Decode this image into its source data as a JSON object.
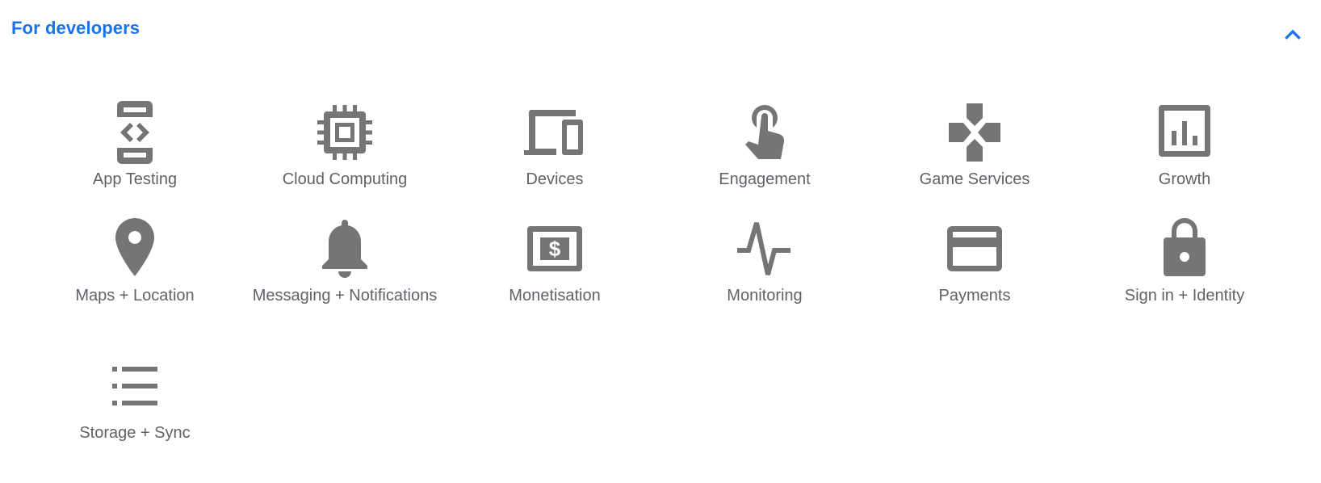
{
  "header": {
    "title": "For developers",
    "collapse_icon": "chevron-up-icon"
  },
  "colors": {
    "accent": "#1a73e8",
    "icon": "#757575",
    "label": "#5f6368",
    "background": "#ffffff"
  },
  "products": [
    {
      "label": "App Testing",
      "icon": "app-testing-icon"
    },
    {
      "label": "Cloud Computing",
      "icon": "cloud-computing-icon"
    },
    {
      "label": "Devices",
      "icon": "devices-icon"
    },
    {
      "label": "Engagement",
      "icon": "engagement-icon"
    },
    {
      "label": "Game Services",
      "icon": "game-services-icon"
    },
    {
      "label": "Growth",
      "icon": "growth-icon"
    },
    {
      "label": "Maps + Location",
      "icon": "maps-location-icon"
    },
    {
      "label": "Messaging + Notifications",
      "icon": "messaging-notifications-icon"
    },
    {
      "label": "Monetisation",
      "icon": "monetisation-icon"
    },
    {
      "label": "Monitoring",
      "icon": "monitoring-icon"
    },
    {
      "label": "Payments",
      "icon": "payments-icon"
    },
    {
      "label": "Sign in + Identity",
      "icon": "sign-in-identity-icon"
    },
    {
      "label": "Storage + Sync",
      "icon": "storage-sync-icon"
    }
  ]
}
